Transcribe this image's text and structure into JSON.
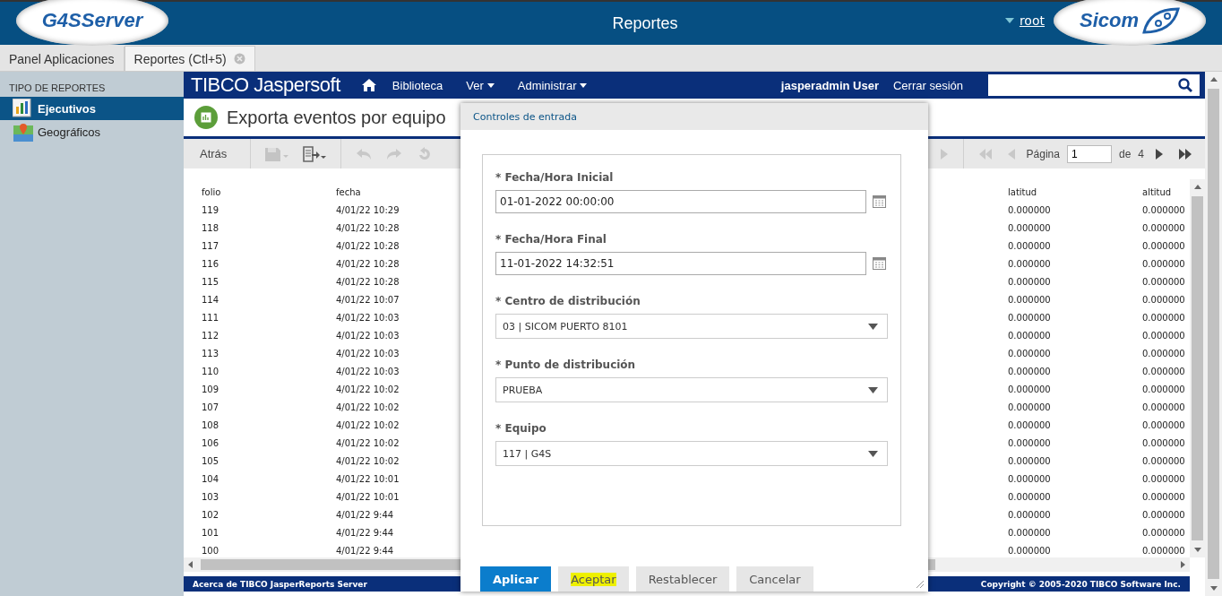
{
  "header": {
    "logo_left": "G4SServer",
    "title": "Reportes",
    "user": "root",
    "logo_right": "Sicom"
  },
  "tabs": [
    {
      "label": "Panel Aplicaciones",
      "selected": false,
      "closable": false
    },
    {
      "label": "Reportes (Ctl+5)",
      "selected": true,
      "closable": true
    }
  ],
  "sidebar": {
    "heading": "TIPO DE REPORTES",
    "items": [
      {
        "label": "Ejecutivos",
        "selected": true,
        "kind": "chart"
      },
      {
        "label": "Geográficos",
        "selected": false,
        "kind": "map"
      }
    ]
  },
  "nav": {
    "logo": "TIBCO Jaspersoft",
    "menu": [
      {
        "label": "Biblioteca",
        "dropdown": false
      },
      {
        "label": "Ver",
        "dropdown": true
      },
      {
        "label": "Administrar",
        "dropdown": true
      }
    ],
    "user": "jasperadmin User",
    "logout": "Cerrar sesión"
  },
  "report": {
    "title": "Exporta eventos por equipo",
    "back": "Atrás",
    "page_label": "Página",
    "page": "1",
    "page_of": "de",
    "page_count": "4",
    "columns": [
      "folio",
      "fecha",
      "latitud",
      "altitud"
    ],
    "rows": [
      [
        "119",
        "4/01/22 10:29",
        "0.000000",
        "0.000000"
      ],
      [
        "118",
        "4/01/22 10:28",
        "0.000000",
        "0.000000"
      ],
      [
        "117",
        "4/01/22 10:28",
        "0.000000",
        "0.000000"
      ],
      [
        "116",
        "4/01/22 10:28",
        "0.000000",
        "0.000000"
      ],
      [
        "115",
        "4/01/22 10:28",
        "0.000000",
        "0.000000"
      ],
      [
        "114",
        "4/01/22 10:07",
        "0.000000",
        "0.000000"
      ],
      [
        "111",
        "4/01/22 10:03",
        "0.000000",
        "0.000000"
      ],
      [
        "112",
        "4/01/22 10:03",
        "0.000000",
        "0.000000"
      ],
      [
        "113",
        "4/01/22 10:03",
        "0.000000",
        "0.000000"
      ],
      [
        "110",
        "4/01/22 10:03",
        "0.000000",
        "0.000000"
      ],
      [
        "109",
        "4/01/22 10:02",
        "0.000000",
        "0.000000"
      ],
      [
        "107",
        "4/01/22 10:02",
        "0.000000",
        "0.000000"
      ],
      [
        "108",
        "4/01/22 10:02",
        "0.000000",
        "0.000000"
      ],
      [
        "106",
        "4/01/22 10:02",
        "0.000000",
        "0.000000"
      ],
      [
        "105",
        "4/01/22 10:02",
        "0.000000",
        "0.000000"
      ],
      [
        "104",
        "4/01/22 10:01",
        "0.000000",
        "0.000000"
      ],
      [
        "103",
        "4/01/22 10:01",
        "0.000000",
        "0.000000"
      ],
      [
        "102",
        "4/01/22 9:44",
        "0.000000",
        "0.000000"
      ],
      [
        "101",
        "4/01/22 9:44",
        "0.000000",
        "0.000000"
      ],
      [
        "100",
        "4/01/22 9:44",
        "0.000000",
        "0.000000"
      ]
    ]
  },
  "footer": {
    "about": "Acerca de TIBCO JasperReports Server",
    "copyright": "Copyright © 2005-2020 TIBCO Software Inc."
  },
  "dialog": {
    "title": "Controles de entrada",
    "fields": [
      {
        "label": "* Fecha/Hora Inicial",
        "value": "01-01-2022 00:00:00",
        "kind": "date"
      },
      {
        "label": "* Fecha/Hora Final",
        "value": "11-01-2022 14:32:51",
        "kind": "date"
      },
      {
        "label": "* Centro de distribución",
        "value": "03 | SICOM PUERTO 8101",
        "kind": "select"
      },
      {
        "label": "* Punto de distribución",
        "value": "PRUEBA",
        "kind": "select"
      },
      {
        "label": "* Equipo",
        "value": "117 | G4S",
        "kind": "select"
      }
    ],
    "buttons": [
      {
        "label": "Aplicar",
        "kind": "primary",
        "highlighted": false
      },
      {
        "label": "Aceptar",
        "kind": "secondary",
        "highlighted": true
      },
      {
        "label": "Restablecer",
        "kind": "secondary",
        "highlighted": false
      },
      {
        "label": "Cancelar",
        "kind": "secondary",
        "highlighted": false
      }
    ]
  }
}
